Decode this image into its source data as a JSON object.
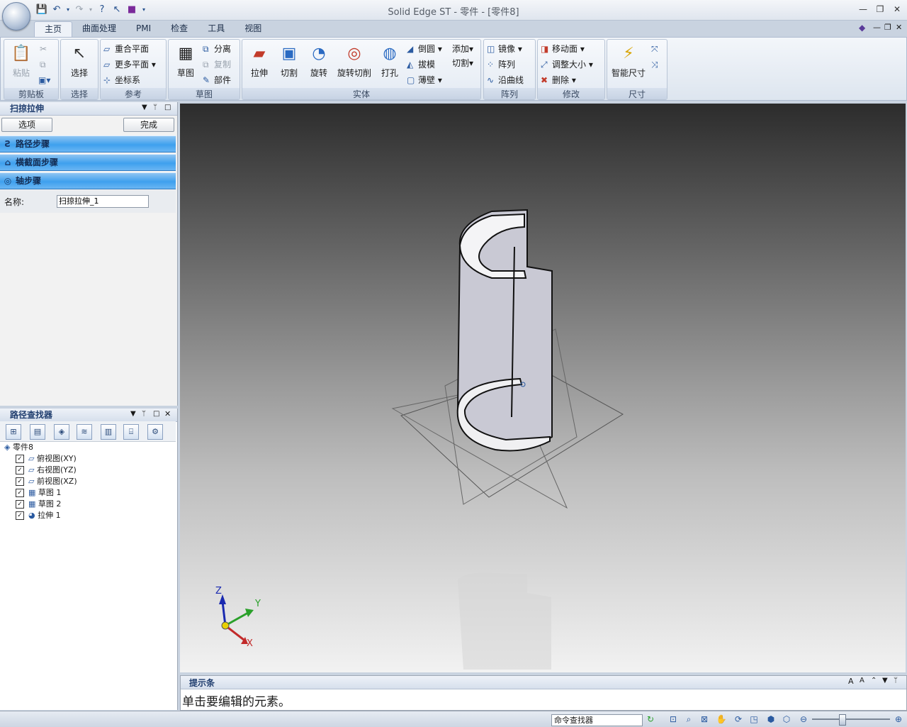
{
  "window": {
    "title": "Solid Edge ST - 零件 - [零件8]"
  },
  "tabs": [
    "主页",
    "曲面处理",
    "PMI",
    "检查",
    "工具",
    "视图"
  ],
  "ribbon": {
    "clipboard": {
      "paste": "粘贴",
      "label": "剪贴板"
    },
    "select": {
      "select": "选择",
      "label": "选择"
    },
    "reference": {
      "coincident_plane": "重合平面",
      "more_planes": "更多平面",
      "coord_sys": "坐标系",
      "label": "参考"
    },
    "sketch": {
      "sketch": "草图",
      "separate": "分离",
      "copy": "复制",
      "part": "部件",
      "label": "草图"
    },
    "solid": {
      "extrude": "拉伸",
      "cut": "切割",
      "revolve": "旋转",
      "revolve_cut": "旋转切削",
      "hole": "打孔",
      "round": "倒圆",
      "draft": "拔模",
      "thin_wall": "薄壁",
      "add": "添加",
      "cut2": "切割",
      "label": "实体"
    },
    "pattern": {
      "mirror": "镜像",
      "pattern": "阵列",
      "along_curve": "沿曲线",
      "label": "阵列"
    },
    "modify": {
      "move_face": "移动面",
      "resize": "调整大小",
      "delete": "删除",
      "label": "修改"
    },
    "dimension": {
      "smart_dim": "智能尺寸",
      "label": "尺寸"
    }
  },
  "sweep_panel": {
    "title": "扫掠拉伸",
    "options_btn": "选项",
    "finish_btn": "完成",
    "steps": [
      "路径步骤",
      "横截面步骤",
      "轴步骤"
    ],
    "name_label": "名称:",
    "name_value": "扫掠拉伸_1"
  },
  "pathfinder": {
    "title": "路径查找器",
    "root": "零件8",
    "items": [
      "俯视图(XY)",
      "右视图(YZ)",
      "前视图(XZ)",
      "草图 1",
      "草图 2",
      "拉伸 1"
    ]
  },
  "triad": {
    "z": "Z",
    "y": "Y",
    "x": "X"
  },
  "prompt": {
    "title": "提示条",
    "message": "单击要编辑的元素。"
  },
  "statusbar": {
    "command_finder": "命令查找器"
  }
}
